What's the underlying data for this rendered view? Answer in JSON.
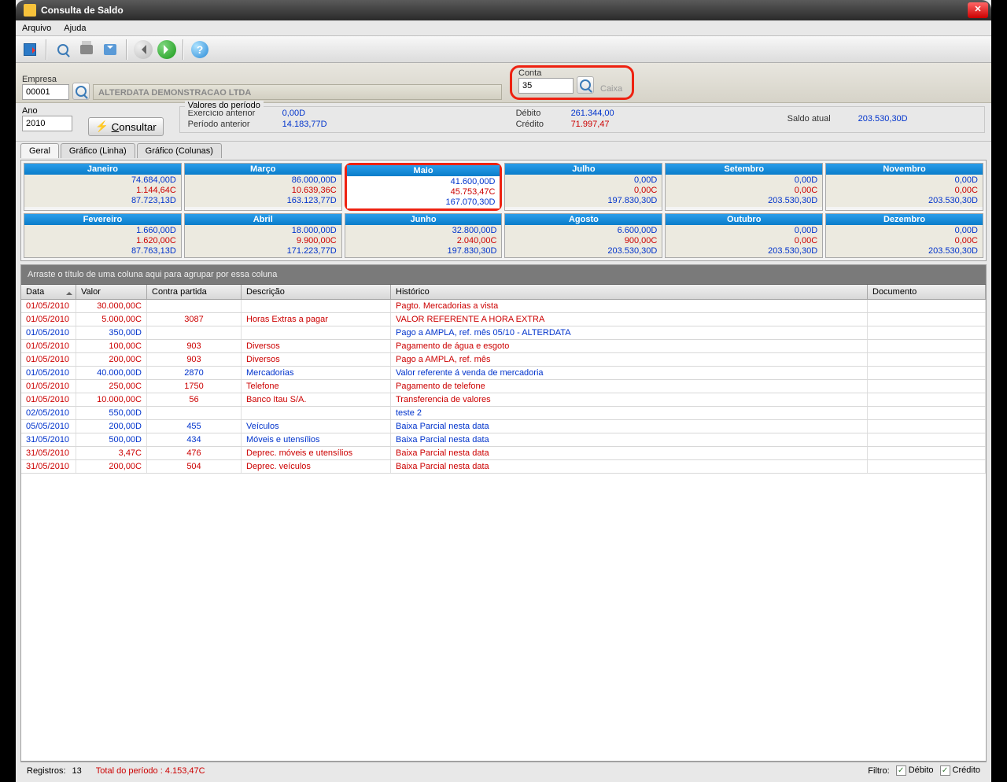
{
  "window": {
    "title": "Consulta de Saldo"
  },
  "menu": {
    "arquivo": "Arquivo",
    "ajuda": "Ajuda"
  },
  "form": {
    "empresa_label": "Empresa",
    "empresa_code": "00001",
    "empresa_name": "ALTERDATA DEMONSTRACAO LTDA",
    "conta_label": "Conta",
    "conta_code": "35",
    "conta_name": "Caixa"
  },
  "mid": {
    "ano_label": "Ano",
    "ano_value": "2010",
    "consultar": "Consultar",
    "valores_legend": "Valores do período",
    "exercicio_ant_label": "Exercício anterior",
    "exercicio_ant_value": "0,00D",
    "periodo_ant_label": "Período anterior",
    "periodo_ant_value": "14.183,77D",
    "debito_label": "Débito",
    "debito_value": "261.344,00",
    "credito_label": "Crédito",
    "credito_value": "71.997,47",
    "saldo_label": "Saldo atual",
    "saldo_value": "203.530,30D"
  },
  "tabs": {
    "geral": "Geral",
    "linha": "Gráfico (Linha)",
    "colunas": "Gráfico (Colunas)"
  },
  "months": [
    {
      "name": "Janeiro",
      "d": "74.684,00D",
      "c": "1.144,64C",
      "s": "87.723,13D"
    },
    {
      "name": "Março",
      "d": "86.000,00D",
      "c": "10.639,36C",
      "s": "163.123,77D"
    },
    {
      "name": "Maio",
      "d": "41.600,00D",
      "c": "45.753,47C",
      "s": "167.070,30D",
      "hl": true
    },
    {
      "name": "Julho",
      "d": "0,00D",
      "c": "0,00C",
      "s": "197.830,30D"
    },
    {
      "name": "Setembro",
      "d": "0,00D",
      "c": "0,00C",
      "s": "203.530,30D"
    },
    {
      "name": "Novembro",
      "d": "0,00D",
      "c": "0,00C",
      "s": "203.530,30D"
    },
    {
      "name": "Fevereiro",
      "d": "1.660,00D",
      "c": "1.620,00C",
      "s": "87.763,13D"
    },
    {
      "name": "Abril",
      "d": "18.000,00D",
      "c": "9.900,00C",
      "s": "171.223,77D"
    },
    {
      "name": "Junho",
      "d": "32.800,00D",
      "c": "2.040,00C",
      "s": "197.830,30D"
    },
    {
      "name": "Agosto",
      "d": "6.600,00D",
      "c": "900,00C",
      "s": "203.530,30D"
    },
    {
      "name": "Outubro",
      "d": "0,00D",
      "c": "0,00C",
      "s": "203.530,30D"
    },
    {
      "name": "Dezembro",
      "d": "0,00D",
      "c": "0,00C",
      "s": "203.530,30D"
    }
  ],
  "grid": {
    "group_hint": "Arraste o título de uma coluna aqui para agrupar por essa coluna",
    "headers": {
      "data": "Data",
      "valor": "Valor",
      "contra": "Contra partida",
      "desc": "Descrição",
      "hist": "Histórico",
      "doc": "Documento"
    },
    "rows": [
      {
        "t": "red",
        "data": "01/05/2010",
        "valor": "30.000,00C",
        "contra": "",
        "desc": "",
        "hist": "Pagto. Mercadorias a vista",
        "doc": ""
      },
      {
        "t": "red",
        "data": "01/05/2010",
        "valor": "5.000,00C",
        "contra": "3087",
        "desc": "Horas Extras a pagar",
        "hist": "VALOR REFERENTE A HORA EXTRA",
        "doc": ""
      },
      {
        "t": "blue",
        "data": "01/05/2010",
        "valor": "350,00D",
        "contra": "",
        "desc": "",
        "hist": "Pago a AMPLA, ref. mês 05/10 - ALTERDATA",
        "doc": ""
      },
      {
        "t": "red",
        "data": "01/05/2010",
        "valor": "100,00C",
        "contra": "903",
        "desc": "Diversos",
        "hist": "Pagamento de água e esgoto",
        "doc": ""
      },
      {
        "t": "red",
        "data": "01/05/2010",
        "valor": "200,00C",
        "contra": "903",
        "desc": "Diversos",
        "hist": "Pago a AMPLA, ref. mês",
        "doc": ""
      },
      {
        "t": "blue",
        "data": "01/05/2010",
        "valor": "40.000,00D",
        "contra": "2870",
        "desc": "Mercadorias",
        "hist": " Valor referente á venda de mercadoria",
        "doc": ""
      },
      {
        "t": "red",
        "data": "01/05/2010",
        "valor": "250,00C",
        "contra": "1750",
        "desc": "Telefone",
        "hist": " Pagamento de telefone",
        "doc": ""
      },
      {
        "t": "red",
        "data": "01/05/2010",
        "valor": "10.000,00C",
        "contra": "56",
        "desc": "Banco Itau S/A.",
        "hist": "Transferencia de valores",
        "doc": ""
      },
      {
        "t": "blue",
        "data": "02/05/2010",
        "valor": "550,00D",
        "contra": "",
        "desc": "",
        "hist": "teste 2",
        "doc": ""
      },
      {
        "t": "blue",
        "data": "05/05/2010",
        "valor": "200,00D",
        "contra": "455",
        "desc": "Veículos",
        "hist": "Baixa Parcial nesta data",
        "doc": ""
      },
      {
        "t": "blue",
        "data": "31/05/2010",
        "valor": "500,00D",
        "contra": "434",
        "desc": "Móveis e utensílios",
        "hist": "Baixa Parcial nesta data",
        "doc": ""
      },
      {
        "t": "red",
        "data": "31/05/2010",
        "valor": "3,47C",
        "contra": "476",
        "desc": "Deprec. móveis e utensílios",
        "hist": "Baixa Parcial nesta data",
        "doc": ""
      },
      {
        "t": "red",
        "data": "31/05/2010",
        "valor": "200,00C",
        "contra": "504",
        "desc": "Deprec. veículos",
        "hist": "Baixa Parcial nesta data",
        "doc": ""
      }
    ]
  },
  "status": {
    "registros_label": "Registros:",
    "registros_value": "13",
    "total_label": "Total do período : 4.153,47C",
    "filtro_label": "Filtro:",
    "debito": "Débito",
    "credito": "Crédito"
  }
}
